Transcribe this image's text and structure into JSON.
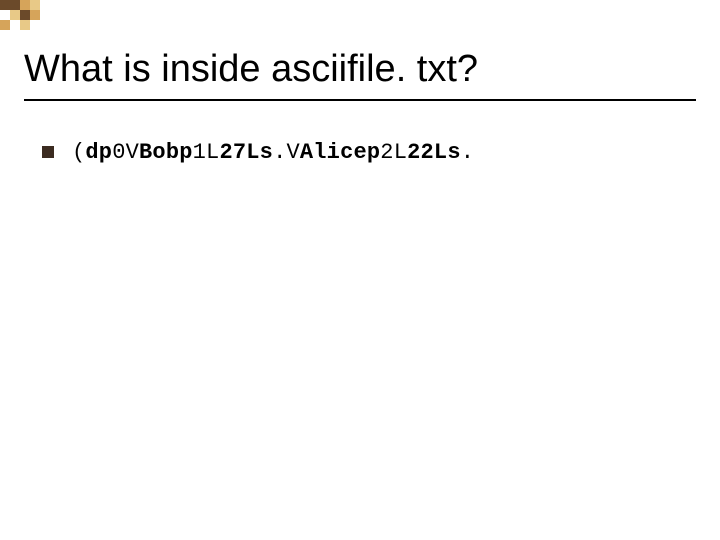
{
  "title": "What is inside asciifile. txt?",
  "code_segments": [
    {
      "text": "(",
      "bold": false
    },
    {
      "text": "dp",
      "bold": true
    },
    {
      "text": "0V",
      "bold": false
    },
    {
      "text": "Bobp",
      "bold": true
    },
    {
      "text": "1L",
      "bold": false
    },
    {
      "text": "27Ls",
      "bold": true
    },
    {
      "text": ".V",
      "bold": false
    },
    {
      "text": "Alicep",
      "bold": true
    },
    {
      "text": "2L",
      "bold": false
    },
    {
      "text": "22Ls",
      "bold": true
    },
    {
      "text": ".",
      "bold": false
    }
  ]
}
